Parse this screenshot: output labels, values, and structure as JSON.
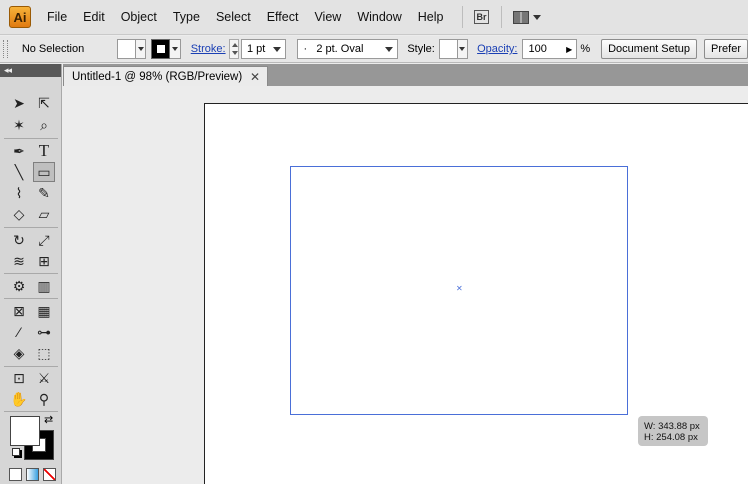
{
  "app": {
    "logo": "Ai"
  },
  "menu": [
    "File",
    "Edit",
    "Object",
    "Type",
    "Select",
    "Effect",
    "View",
    "Window",
    "Help"
  ],
  "menu_tools": {
    "bridge": "Br"
  },
  "control": {
    "selection": "No Selection",
    "stroke_label": "Stroke:",
    "stroke_weight": "1 pt",
    "brush_label": "2 pt. Oval",
    "style_label": "Style:",
    "opacity_label": "Opacity:",
    "opacity_value": "100",
    "opacity_unit": "%",
    "doc_setup": "Document Setup",
    "prefs": "Prefer"
  },
  "doc": {
    "tab_title": "Untitled-1 @ 98% (RGB/Preview)",
    "close": "✕"
  },
  "canvas": {
    "width_readout": "W: 343.88 px",
    "height_readout": "H: 254.08 px"
  },
  "tools": {
    "selection": "➤",
    "direct": "⇱",
    "magic": "✶",
    "lasso": "⌕",
    "pen": "✒",
    "type": "T",
    "line": "╲",
    "rect": "▭",
    "brush": "⌇",
    "pencil": "✎",
    "blob": "◇",
    "eraser": "▱",
    "rotate": "↻",
    "scale": "⤢",
    "warp": "≋",
    "free": "⊞",
    "symbol": "⚙",
    "graph": "▥",
    "mesh": "⊠",
    "gradient": "▦",
    "eyedrop": "⁄",
    "blend": "⊶",
    "paintbucket": "◈",
    "livesel": "⬚",
    "artboard": "⊡",
    "slice": "⚔",
    "hand": "✋",
    "zoom": "⚲"
  },
  "colors": {
    "accent": "#4a6fd8",
    "link": "#1a3fb4"
  }
}
